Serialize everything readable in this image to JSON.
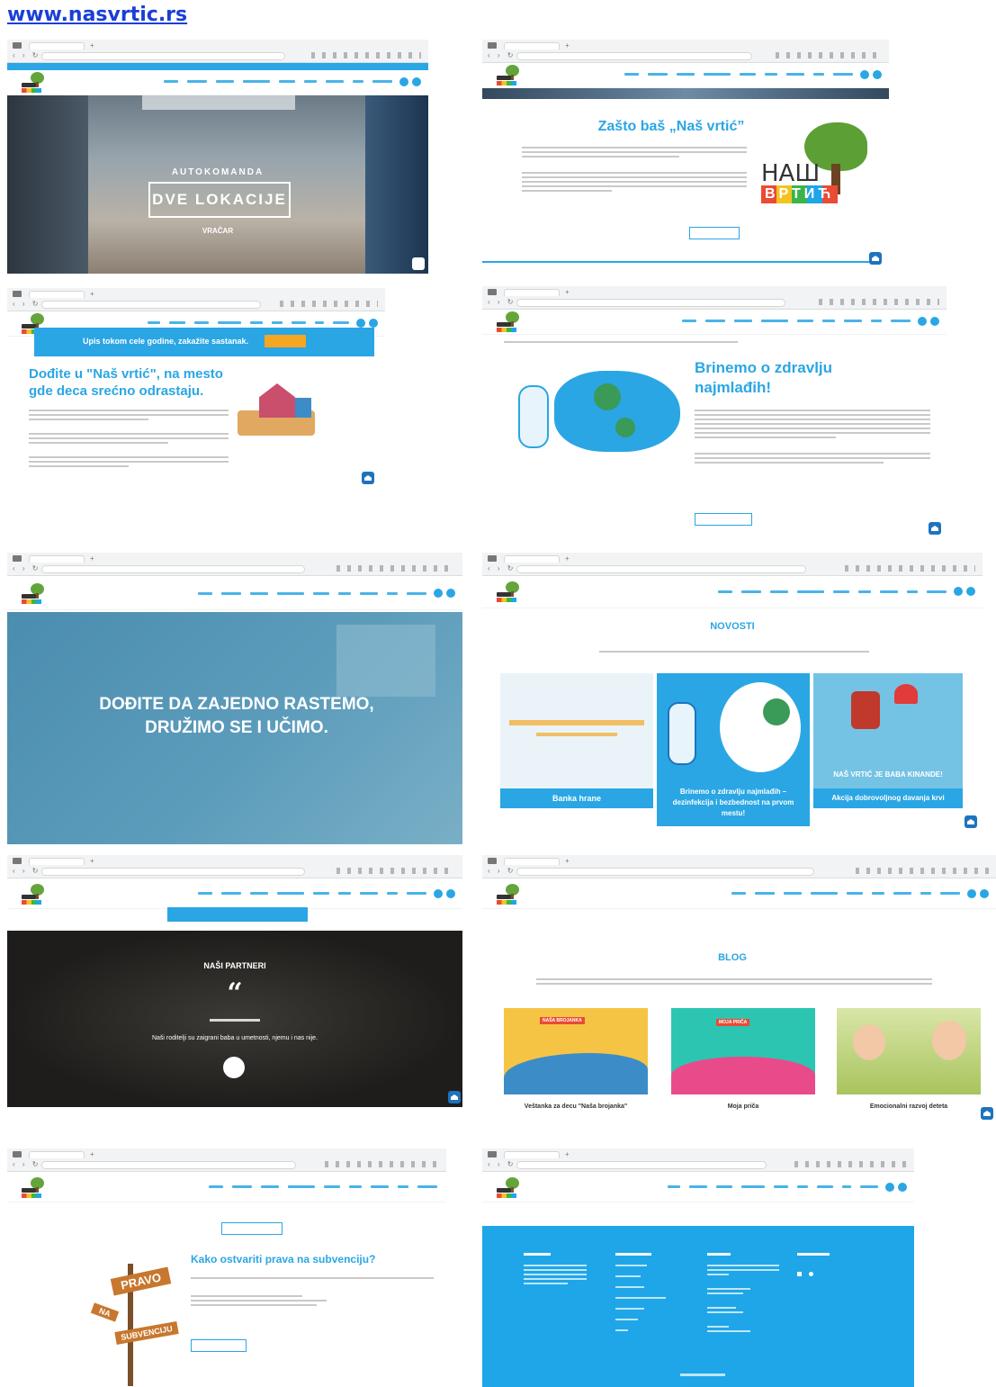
{
  "page": {
    "title": "www.nasvrtic.rs"
  },
  "colors": {
    "brand": "#2aa6e4",
    "link": "#1a3fd6",
    "dark_overlay": "#1e1e1e",
    "teal_overlay": "#4c8fb0"
  },
  "shot1": {
    "hero_small": "AUTOKOMANDA",
    "hero_box": "DVE LOKACIJE",
    "hero_link": "VRAČAR"
  },
  "shot2": {
    "heading": "Zašto baš „Naš vrtić”",
    "logo_word": "НАШ",
    "logo_flags": "ВРТИЋ"
  },
  "shot3": {
    "banner": "Upis tokom cele godine, zakažite sastanak.",
    "heading": "Dođite u \"Naš vrtić\", na mesto gde deca srećno odrastaju."
  },
  "shot4": {
    "heading": "Brinemo o zdravlju najmlađih!"
  },
  "shot5": {
    "hero": "DOĐITE DA ZAJEDNO RASTEMO, DRUŽIMO SE I UČIMO."
  },
  "shot6": {
    "heading": "NOVOSTI",
    "cards": [
      {
        "title": "Banka hrane",
        "overlay": ""
      },
      {
        "title": "Brinemo o zdravlju najmlađih – dezinfekcija i bezbednost na prvom mestu!",
        "overlay": ""
      },
      {
        "title": "Akcija dobrovoljnog davanja krvi",
        "overlay": "NAŠ VRTIĆ JE BABA KINANDE!"
      }
    ]
  },
  "shot7": {
    "heading": "NAŠI PARTNERI",
    "quote_mark": "“",
    "quote": "Naši roditelji su zaigrani baba u umetnosti, njemu i nas nije."
  },
  "shot8": {
    "heading": "BLOG",
    "posts": [
      {
        "title": "Veštanka za decu \"Naša brojanka\"",
        "badge": "NAŠA BROJANKA"
      },
      {
        "title": "Moja priča",
        "badge": "MOJA PRIČA"
      },
      {
        "title": "Emocionalni razvoj deteta",
        "badge": ""
      }
    ]
  },
  "shot9": {
    "heading": "Kako ostvariti prava na subvenciju?",
    "sign1": "PRAVO",
    "sign2": "NA",
    "sign3": "SUBVENCIJU"
  }
}
